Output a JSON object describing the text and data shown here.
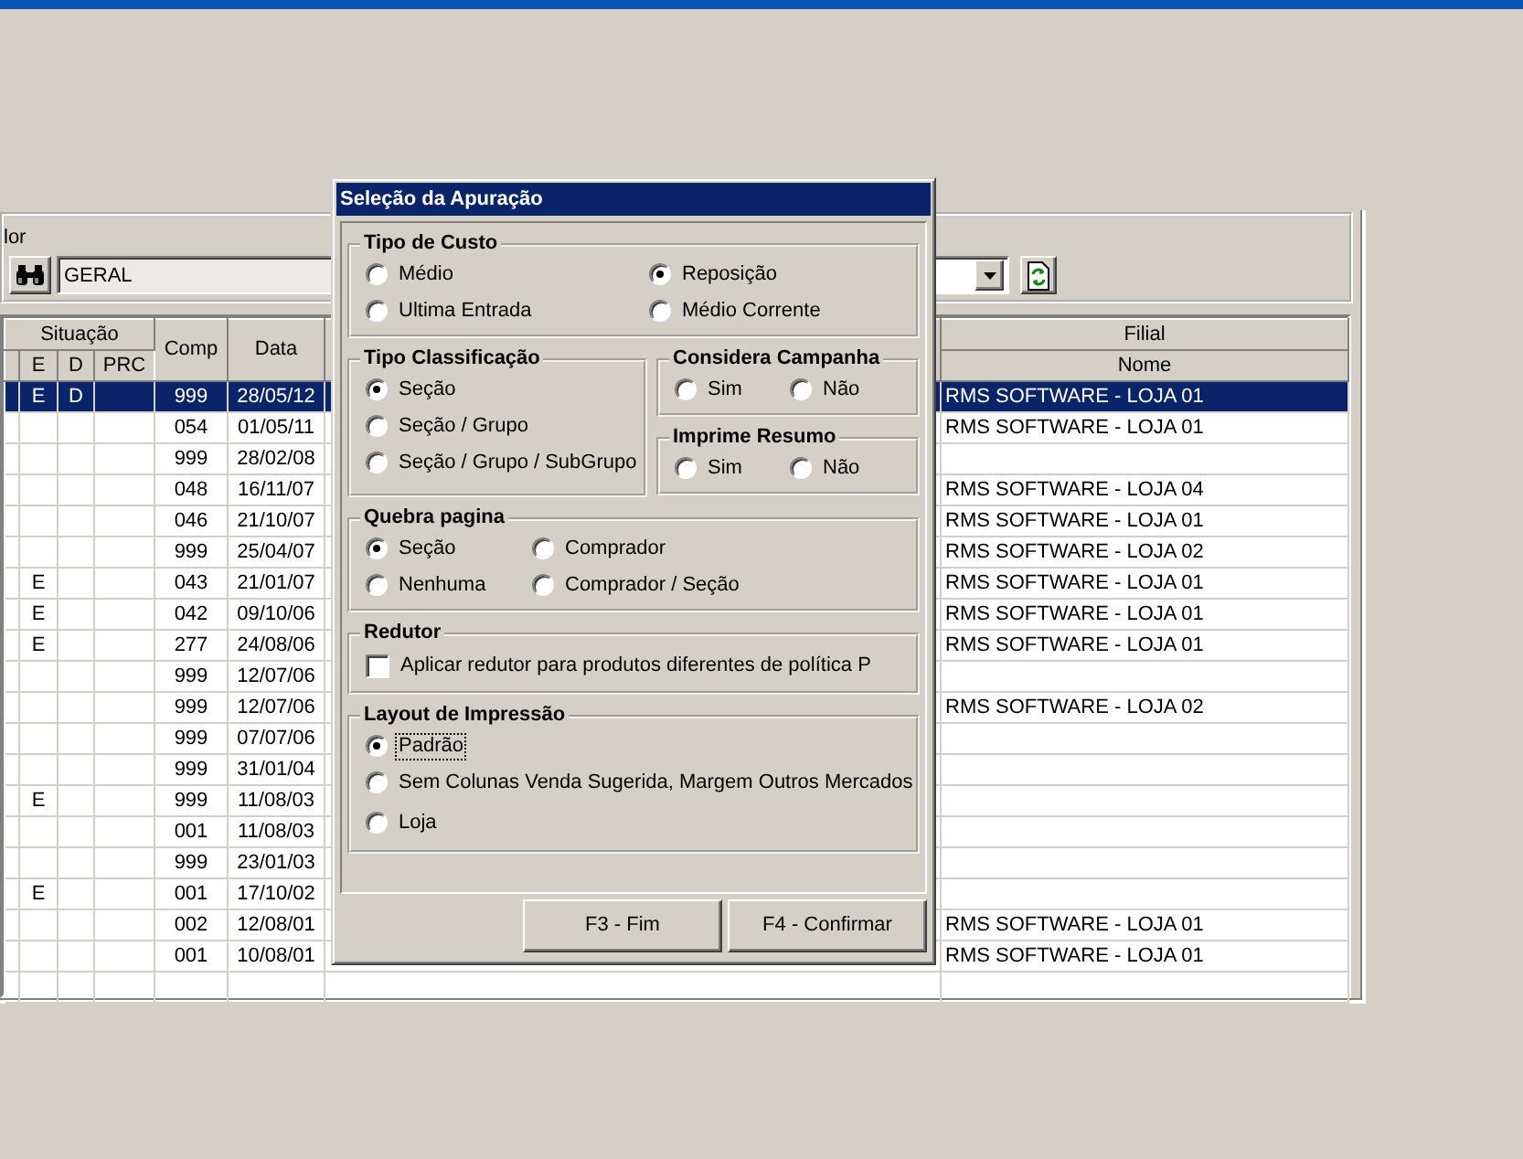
{
  "filter": {
    "label": "lor",
    "search_value": "GERAL"
  },
  "grid": {
    "header_groups": [
      "Situação",
      "Filial"
    ],
    "columns": [
      "E",
      "D",
      "PRC",
      "Comp",
      "Data",
      "Nome"
    ],
    "rows": [
      {
        "e": "E",
        "d": "D",
        "comp": "999",
        "data": "28/05/12",
        "nome": "RMS SOFTWARE - LOJA 01",
        "selected": true
      },
      {
        "comp": "054",
        "data": "01/05/11",
        "nome": "RMS SOFTWARE - LOJA 01",
        "selected": false
      },
      {
        "comp": "999",
        "data": "28/02/08",
        "selected": false
      },
      {
        "comp": "048",
        "data": "16/11/07",
        "nome": "RMS SOFTWARE - LOJA 04",
        "selected": false
      },
      {
        "comp": "046",
        "data": "21/10/07",
        "nome": "RMS SOFTWARE - LOJA 01",
        "selected": false
      },
      {
        "comp": "999",
        "data": "25/04/07",
        "nome": "RMS SOFTWARE - LOJA 02",
        "selected": false
      },
      {
        "e": "E",
        "comp": "043",
        "data": "21/01/07",
        "nome": "RMS SOFTWARE - LOJA 01",
        "selected": false
      },
      {
        "e": "E",
        "comp": "042",
        "data": "09/10/06",
        "nome": "RMS SOFTWARE - LOJA 01",
        "selected": false
      },
      {
        "e": "E",
        "comp": "277",
        "data": "24/08/06",
        "nome": "RMS SOFTWARE - LOJA 01",
        "selected": false
      },
      {
        "comp": "999",
        "data": "12/07/06",
        "selected": false
      },
      {
        "comp": "999",
        "data": "12/07/06",
        "nome": "RMS SOFTWARE - LOJA 02",
        "selected": false
      },
      {
        "comp": "999",
        "data": "07/07/06",
        "selected": false
      },
      {
        "comp": "999",
        "data": "31/01/04",
        "selected": false
      },
      {
        "e": "E",
        "comp": "999",
        "data": "11/08/03",
        "selected": false
      },
      {
        "comp": "001",
        "data": "11/08/03",
        "selected": false
      },
      {
        "comp": "999",
        "data": "23/01/03",
        "selected": false
      },
      {
        "e": "E",
        "comp": "001",
        "data": "17/10/02",
        "selected": false
      },
      {
        "comp": "002",
        "data": "12/08/01",
        "nome": "RMS SOFTWARE - LOJA 01",
        "selected": false
      },
      {
        "comp": "001",
        "data": "10/08/01",
        "nome": "RMS SOFTWARE - LOJA 01",
        "selected": false
      }
    ]
  },
  "dialog": {
    "title": "Seleção da Apuração",
    "groups": [
      {
        "title": "Tipo de Custo",
        "kind": "radio",
        "rows": [
          [
            {
              "label": "Médio",
              "selected": false
            },
            {
              "label": "Reposição",
              "selected": true
            }
          ],
          [
            {
              "label": "Ultima Entrada",
              "selected": false
            },
            {
              "label": "Médio Corrente",
              "selected": false
            }
          ]
        ]
      },
      {
        "title": "Tipo Classificação",
        "kind": "radio",
        "rows": [
          [
            {
              "label": "Seção",
              "selected": true
            }
          ],
          [
            {
              "label": "Seção / Grupo",
              "selected": false
            }
          ],
          [
            {
              "label": "Seção / Grupo / SubGrupo",
              "selected": false
            }
          ]
        ]
      },
      {
        "title": "Considera Campanha",
        "kind": "radio",
        "rows": [
          [
            {
              "label": "Sim",
              "selected": false
            },
            {
              "label": "Não",
              "selected": false
            }
          ]
        ]
      },
      {
        "title": "Imprime Resumo",
        "kind": "radio",
        "rows": [
          [
            {
              "label": "Sim",
              "selected": false
            },
            {
              "label": "Não",
              "selected": false
            }
          ]
        ]
      },
      {
        "title": "Quebra pagina",
        "kind": "radio",
        "rows": [
          [
            {
              "label": "Seção",
              "selected": true
            },
            {
              "label": "Comprador",
              "selected": false
            }
          ],
          [
            {
              "label": "Nenhuma",
              "selected": false
            },
            {
              "label": "Comprador / Seção",
              "selected": false
            }
          ]
        ]
      },
      {
        "title": "Redutor",
        "kind": "checkbox",
        "rows": [
          [
            {
              "label": "Aplicar redutor para produtos diferentes de política P",
              "checked": false
            }
          ]
        ]
      },
      {
        "title": "Layout de Impressão",
        "kind": "radio",
        "rows": [
          [
            {
              "label": "Padrão",
              "selected": true,
              "focused": true
            }
          ],
          [
            {
              "label": "Sem Colunas Venda Sugerida, Margem Outros Mercados",
              "selected": false,
              "focused": false
            }
          ],
          [
            {
              "label": "Loja",
              "selected": false,
              "focused": false
            }
          ]
        ]
      }
    ],
    "buttons": [
      {
        "label": "F3 - Fim"
      },
      {
        "label": "F4 - Confirmar"
      }
    ]
  }
}
